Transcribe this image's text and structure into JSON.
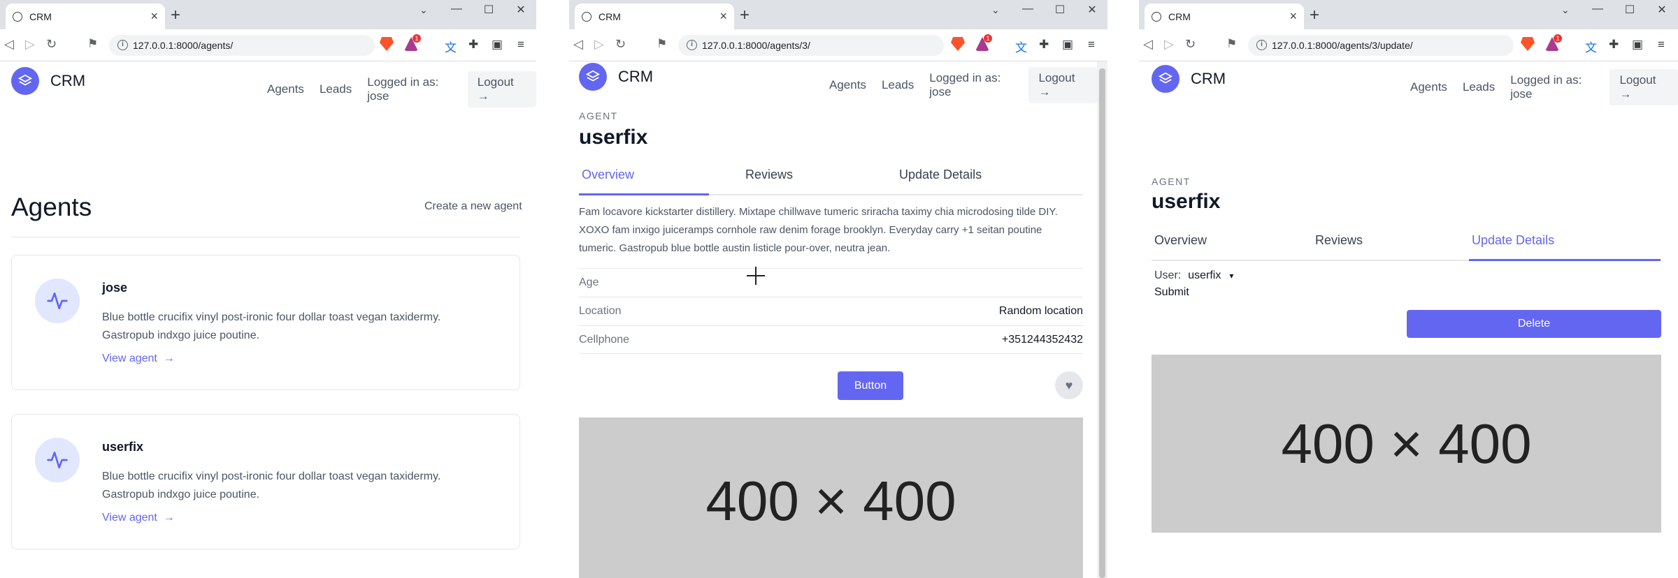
{
  "browser": {
    "tab_title": "CRM",
    "new_tab": "+",
    "close_tab": "×",
    "window_controls": {
      "min": "—",
      "max": "☐",
      "close": "✕"
    },
    "urls": [
      "127.0.0.1:8000/agents/",
      "127.0.0.1:8000/agents/3/",
      "127.0.0.1:8000/agents/3/update/"
    ],
    "ext_badge": "1"
  },
  "site": {
    "brand": "CRM",
    "nav": {
      "agents": "Agents",
      "leads": "Leads",
      "logged_in": "Logged in as: jose",
      "logout": "Logout"
    }
  },
  "list_page": {
    "heading": "Agents",
    "create_link": "Create a new agent",
    "agents": [
      {
        "name": "jose",
        "description": "Blue bottle crucifix vinyl post-ironic four dollar toast vegan taxidermy. Gastropub indxgo juice poutine.",
        "link": "View agent"
      },
      {
        "name": "userfix",
        "description": "Blue bottle crucifix vinyl post-ironic four dollar toast vegan taxidermy. Gastropub indxgo juice poutine.",
        "link": "View agent"
      }
    ]
  },
  "detail_page": {
    "eyebrow": "AGENT",
    "name": "userfix",
    "tabs": [
      "Overview",
      "Reviews",
      "Update Details"
    ],
    "active_tab": "Overview",
    "description": "Fam locavore kickstarter distillery. Mixtape chillwave tumeric sriracha taximy chia microdosing tilde DIY. XOXO fam inxigo juiceramps cornhole raw denim forage brooklyn. Everyday carry +1 seitan poutine tumeric. Gastropub blue bottle austin listicle pour-over, neutra jean.",
    "fields": [
      {
        "label": "Age",
        "value": ""
      },
      {
        "label": "Location",
        "value": "Random location"
      },
      {
        "label": "Cellphone",
        "value": "+351244352432"
      }
    ],
    "button": "Button",
    "image_text": "400 × 400"
  },
  "update_page": {
    "eyebrow": "AGENT",
    "name": "userfix",
    "tabs": [
      "Overview",
      "Reviews",
      "Update Details"
    ],
    "active_tab": "Update Details",
    "user_label": "User:",
    "user_value": "userfix",
    "submit": "Submit",
    "delete": "Delete",
    "image_text": "400 × 400"
  },
  "colors": {
    "accent": "#6366f1",
    "placeholder": "#cccccc"
  }
}
